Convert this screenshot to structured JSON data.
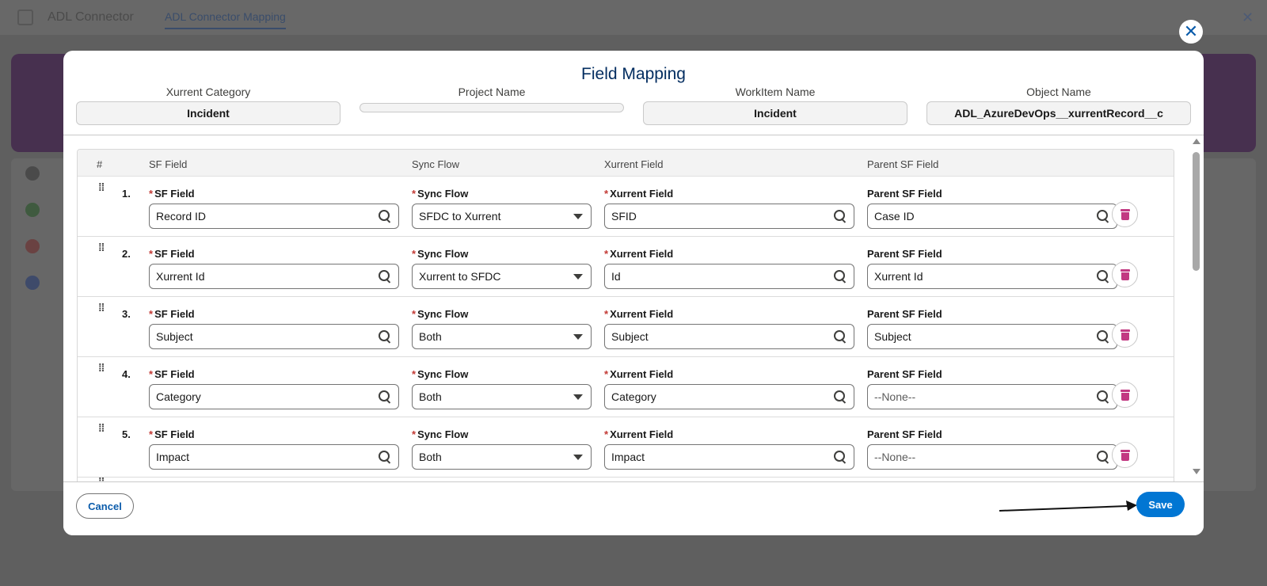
{
  "background": {
    "brand": "ADL Connector",
    "tab": "ADL Connector Mapping"
  },
  "modal": {
    "title": "Field Mapping",
    "meta": [
      {
        "label": "Xurrent Category",
        "value": "Incident"
      },
      {
        "label": "Project Name",
        "value": ""
      },
      {
        "label": "WorkItem Name",
        "value": "Incident"
      },
      {
        "label": "Object Name",
        "value": "ADL_AzureDevOps__xurrentRecord__c"
      }
    ],
    "table": {
      "headers": [
        "#",
        "SF Field",
        "Sync Flow",
        "Xurrent Field",
        "Parent SF Field"
      ],
      "field_labels": {
        "sf": "SF Field",
        "sync": "Sync Flow",
        "xurrent": "Xurrent Field",
        "parent": "Parent SF Field",
        "required_mark": "*"
      },
      "rows": [
        {
          "num": "1.",
          "sf": "Record ID",
          "sync": "SFDC to Xurrent",
          "xurrent": "SFID",
          "parent": "Case ID"
        },
        {
          "num": "2.",
          "sf": "Xurrent Id",
          "sync": "Xurrent to SFDC",
          "xurrent": "Id",
          "parent": "Xurrent Id"
        },
        {
          "num": "3.",
          "sf": "Subject",
          "sync": "Both",
          "xurrent": "Subject",
          "parent": "Subject"
        },
        {
          "num": "4.",
          "sf": "Category",
          "sync": "Both",
          "xurrent": "Category",
          "parent": "--None--"
        },
        {
          "num": "5.",
          "sf": "Impact",
          "sync": "Both",
          "xurrent": "Impact",
          "parent": "--None--"
        }
      ]
    },
    "footer": {
      "cancel_label": "Cancel",
      "save_label": "Save"
    }
  },
  "colors": {
    "brand_blue": "#0176d3",
    "title_navy": "#032d60",
    "required_red": "#c23934",
    "delete_pink": "#c23982"
  }
}
